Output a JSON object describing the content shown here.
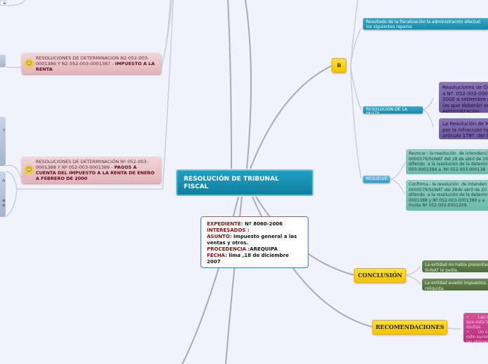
{
  "central": {
    "title": "RESOLUCIÓN  DE TRIBUNAL FISCAL"
  },
  "info": {
    "expediente_label": "EXPEDIENTE:",
    "expediente": " Nº 8060-2006",
    "interesados_label": "INTERESADOS :",
    "asunto_label": "ASUNTO:",
    "asunto": " Impuesto general a las ventas y otros.",
    "procedencia_label": "PROCEDENCIA :",
    "procedencia": "AREQUIPA",
    "fecha_label": "FECHA:",
    "fecha": " lima ,18 de diciembre 2007"
  },
  "left": {
    "node1": {
      "prefix": "RESOLUCIONES DE DETERMINACION N2 052-003-0001386 Y N2 052-003-0001387 - ",
      "bold": "IMPUESTO A LA RENTA"
    },
    "node2": {
      "prefix": "RESOLUCIONES DE DETERMINACIÓN Nº  052-003-0001388 Y Nº  052-003-0001389 - ",
      "bold": "PAGOS A CUENTA DEL IMPUESTO A LA RENTA DE ENERO A FEBRERO DE 2000"
    },
    "edge_fragments": [
      "a",
      "r",
      "n",
      "a",
      "o"
    ]
  },
  "b_node": {
    "label": "B"
  },
  "right": {
    "fiscalizacion": "Resultado de la fiscalización la administración efectuó los siguientes reparos",
    "multa": {
      "label": "RESOLUCION  DE LA MULTA",
      "items": [
        "Resoluciones de Det\na Nº  052-003-0001\n2000 a setiembre de\nlas que deberán ser\nAdministración.",
        "La Resolución de Mu\npor la infracción tipi\nartículo 178º  del Có"
      ]
    },
    "resuelve": {
      "label": "RESUELVE:",
      "items": [
        "Revocar.- la resolución  de intendenci\n0000579/SUNAT del 28 de abril de 20\ndiferido  a la resolución de la determi\n003-0001384 a  Nº 052-003-000138",
        "Confirma.- la resolución  de intenden\n0000579/SUNAT del 28de abril de 20\ndiferido  a la resolución de la determi\n0001388 y Nº 052-003-0001389 y a\nmulta Nº 052-002-0001209."
      ]
    },
    "conclusion": {
      "label": "CONCLUSIÓN",
      "items": [
        "La entidad no había presentado l\nSUNAT le pedía.",
        "La entidad evadió impuestos, po\nreliquida."
      ]
    },
    "recomendaciones": {
      "label": "RECOMENDACIONES",
      "text": "•       Las e\nque esta le\nmultas.\n•       Un co\neste suceda\nlas obligaci"
    }
  },
  "colors": {
    "central": "#1693b5",
    "teal": "#2a9fbd",
    "yellow": "#f9cf00",
    "purple": "#7a65ab",
    "mint": "#7fc6b5",
    "olive": "#5b7a48",
    "magenta": "#c4408a",
    "pink": "#e8c2c5"
  }
}
